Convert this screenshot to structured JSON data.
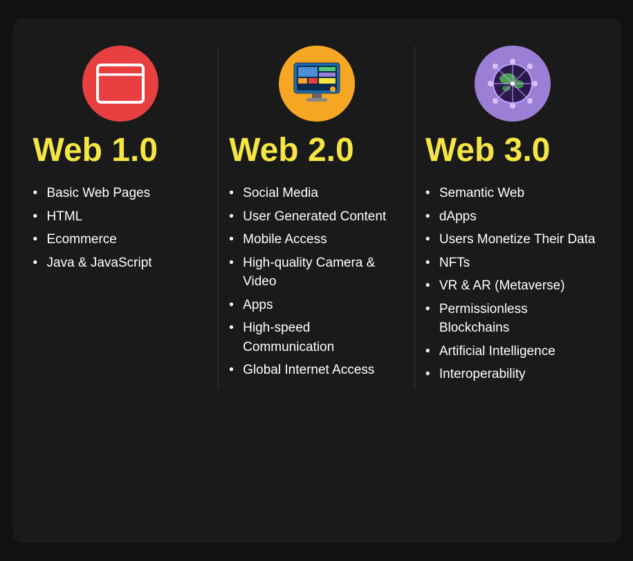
{
  "columns": [
    {
      "id": "web1",
      "icon_type": "browser",
      "icon_bg": "web1",
      "heading": "Web 1.0",
      "items": [
        "Basic Web Pages",
        "HTML",
        "Ecommerce",
        "Java & JavaScript"
      ]
    },
    {
      "id": "web2",
      "icon_type": "monitor",
      "icon_bg": "web2",
      "heading": "Web 2.0",
      "items": [
        "Social Media",
        "User Generated Content",
        "Mobile Access",
        "High-quality Camera & Video",
        "Apps",
        "High-speed Communication",
        "Global Internet Access"
      ]
    },
    {
      "id": "web3",
      "icon_type": "network",
      "icon_bg": "web3",
      "heading": "Web 3.0",
      "items": [
        "Semantic Web",
        "dApps",
        "Users Monetize Their Data",
        "NFTs",
        "VR & AR (Metaverse)",
        "Permissionless Blockchains",
        "Artificial Intelligence",
        "Interoperability"
      ]
    }
  ]
}
